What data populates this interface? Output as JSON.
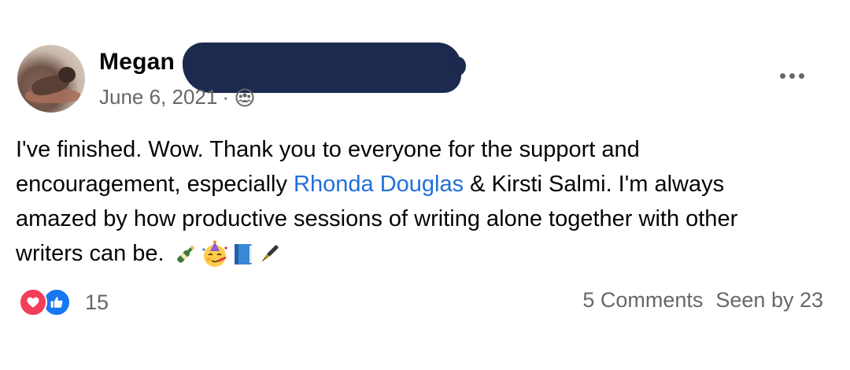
{
  "post": {
    "author": {
      "name": "Megan",
      "name_redacted": true
    },
    "date": "June 6, 2021",
    "separator": "·",
    "audience_icon": "group-icon",
    "more_icon": "more-options-icon",
    "body": {
      "segment1": "I've finished. Wow. Thank you to everyone for the support and encouragement, especially ",
      "mention1": "Rhonda Douglas",
      "segment2": " & Kirsti Salmi. I'm always amazed by how productive sessions of writing alone together with other writers can be.",
      "emojis": [
        "champagne-bottle-icon",
        "party-face-icon",
        "blue-book-icon",
        "fountain-pen-icon"
      ]
    },
    "reactions": {
      "types": [
        "love-icon",
        "like-icon"
      ],
      "count": "15"
    },
    "comments_label": "5 Comments",
    "seen_label": "Seen by 23"
  },
  "colors": {
    "mention": "#216fdb",
    "muted": "#65676b",
    "love": "#f33e58",
    "like": "#1877f2",
    "redaction": "#1b2a4e"
  }
}
